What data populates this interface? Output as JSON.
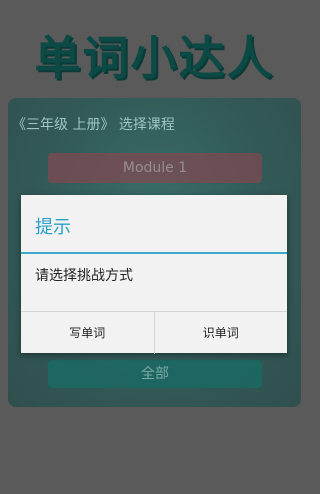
{
  "app": {
    "title": "单词小达人"
  },
  "panel": {
    "title": "《三年级 上册》 选择课程",
    "module_label": "Module 1",
    "all_label": "全部"
  },
  "dialog": {
    "title": "提示",
    "message": "请选择挑战方式",
    "buttons": [
      "写单词",
      "识单词"
    ]
  },
  "colors": {
    "dialog_accent": "#2aa1c7",
    "panel_teal": "#125954",
    "module_button": "#7e4a52"
  }
}
